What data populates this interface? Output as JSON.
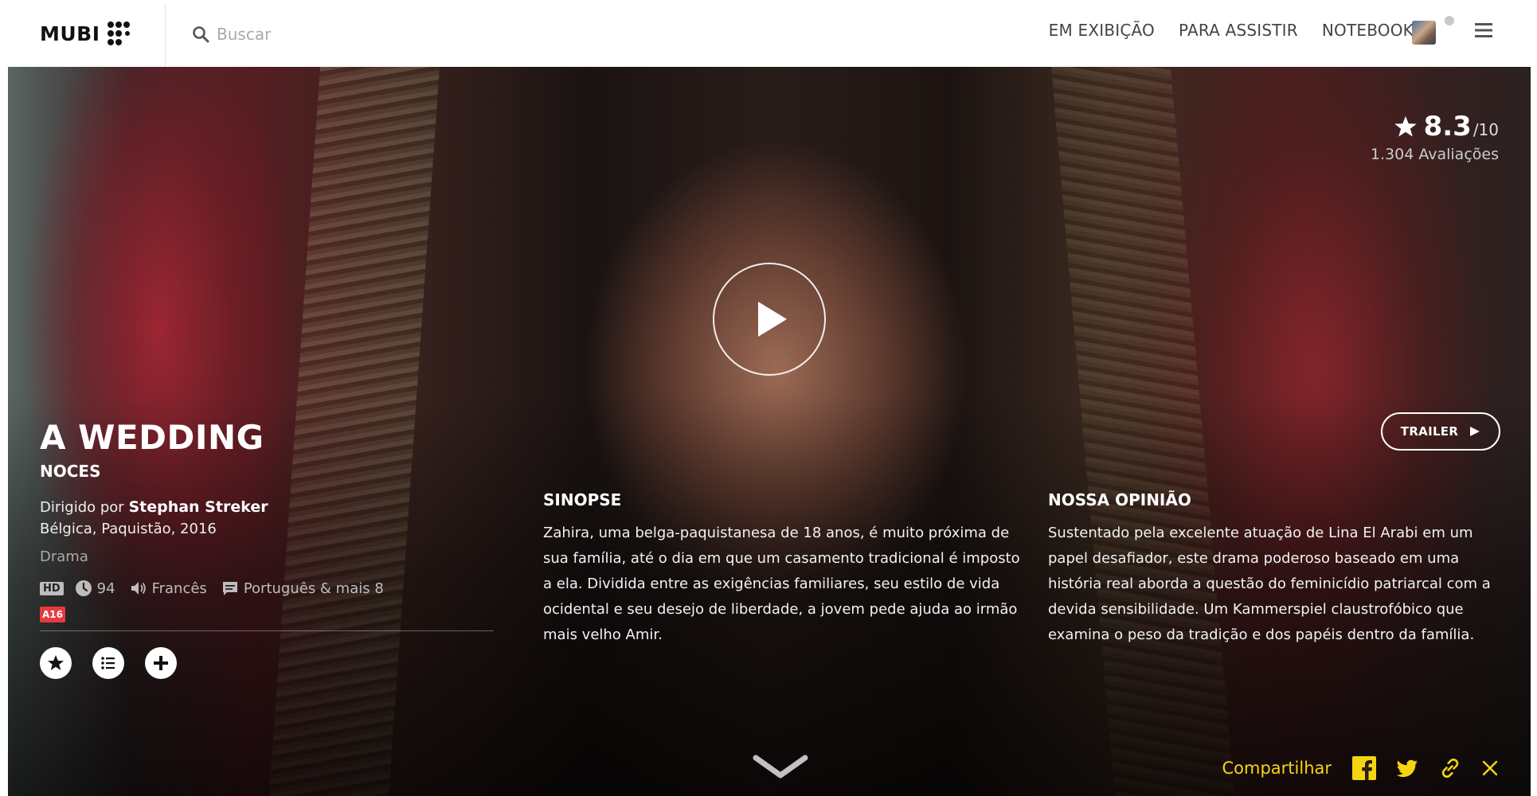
{
  "header": {
    "logo_text": "MUBI",
    "search_placeholder": "Buscar",
    "nav": [
      "EM EXIBIÇÃO",
      "PARA ASSISTIR",
      "NOTEBOOK"
    ]
  },
  "film": {
    "title": "A WEDDING",
    "original_title": "NOCES",
    "directed_by_label": "Dirigido por",
    "director": "Stephan Streker",
    "country_year": "Bélgica, Paquistão, 2016",
    "genre": "Drama",
    "quality": "HD",
    "duration": "94",
    "audio": "Francês",
    "subtitles": "Português & mais 8",
    "age_rating": "A16"
  },
  "rating": {
    "score": "8.3",
    "max": "/10",
    "count": "1.304 Avaliações"
  },
  "trailer_label": "TRAILER",
  "synopsis": {
    "heading": "SINOPSE",
    "body": "Zahira, uma belga-paquistanesa de 18 anos, é muito próxima de sua família, até o dia em que um casamento tradicional é imposto a ela. Dividida entre as exigências familiares, seu estilo de vida ocidental e seu desejo de liberdade, a jovem pede ajuda ao irmão mais velho Amir."
  },
  "opinion": {
    "heading": "NOSSA OPINIÃO",
    "body": "Sustentado pela excelente atuação de Lina El Arabi em um papel desafiador, este drama poderoso baseado em uma história real aborda a questão do feminicídio patriarcal com a devida sensibilidade. Um Kammerspiel claustrofóbico que examina o peso da tradição e dos papéis dentro da família."
  },
  "share": {
    "label": "Compartilhar"
  },
  "colors": {
    "share_accent": "#f5d60e",
    "age_badge": "#e53a40"
  },
  "icons": [
    "search-icon",
    "menu-icon",
    "play-icon",
    "star-icon",
    "clock-icon",
    "speaker-icon",
    "subtitles-icon",
    "rate-icon",
    "list-icon",
    "add-icon",
    "chevron-down-icon",
    "facebook-icon",
    "twitter-icon",
    "link-icon",
    "close-icon"
  ]
}
